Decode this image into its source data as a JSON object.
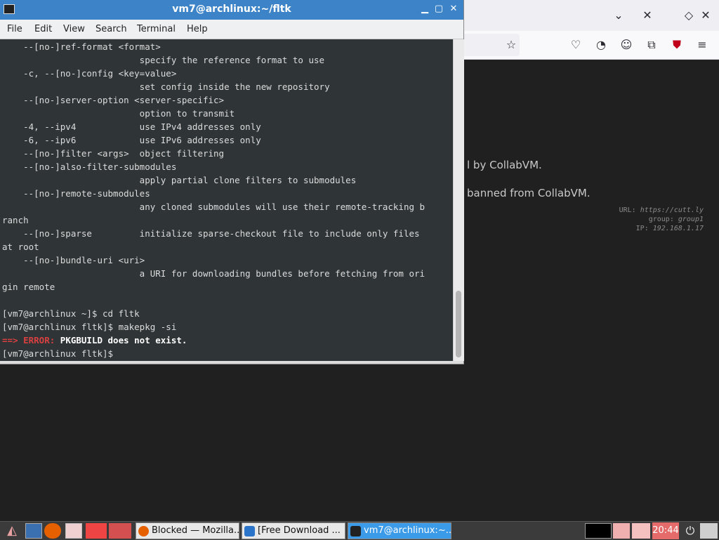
{
  "terminal": {
    "title": "vm7@archlinux:~/fltk",
    "controls": {
      "minimize": "▁",
      "maximize": "▢",
      "close": "✕"
    },
    "menu": [
      "File",
      "Edit",
      "View",
      "Search",
      "Terminal",
      "Help"
    ],
    "lines_top": "    --[no-]ref-format <format>\n                          specify the reference format to use\n    -c, --[no-]config <key=value>\n                          set config inside the new repository\n    --[no-]server-option <server-specific>\n                          option to transmit\n    -4, --ipv4            use IPv4 addresses only\n    -6, --ipv6            use IPv6 addresses only\n    --[no-]filter <args>  object filtering\n    --[no-]also-filter-submodules\n                          apply partial clone filters to submodules\n    --[no-]remote-submodules\n                          any cloned submodules will use their remote-tracking b\nranch\n    --[no-]sparse         initialize sparse-checkout file to include only files\nat root\n    --[no-]bundle-uri <uri>\n                          a URI for downloading bundles before fetching from ori\ngin remote\n\n[vm7@archlinux ~]$ cd fltk\n[vm7@archlinux fltk]$ makepkg -si",
    "error_arrow": "==> ",
    "error_label": "ERROR:",
    "error_message": " PKGBUILD does not exist.",
    "last_prompt": "[vm7@archlinux fltk]$"
  },
  "browser": {
    "icons": [
      "chevron-down-icon",
      "close-icon",
      "diamond-icon",
      "star-icon",
      "pocket-icon",
      "history-icon",
      "account-icon",
      "extensions-icon",
      "ublock-icon",
      "menu-icon"
    ],
    "page_lines": [
      "l by CollabVM.",
      " banned from CollabVM."
    ],
    "vm_info": {
      "url_label": "URL:",
      "url_value": "https://cutt.ly",
      "group_label": "group:",
      "group_value": "group1",
      "ip_label": "IP:",
      "ip_value": "192.168.1.17"
    }
  },
  "taskbar": {
    "tasks": [
      {
        "label": "Blocked — Mozilla..."
      },
      {
        "label": "[Free Download ..."
      },
      {
        "label": "vm7@archlinux:~..."
      }
    ],
    "clock": "20:44"
  }
}
